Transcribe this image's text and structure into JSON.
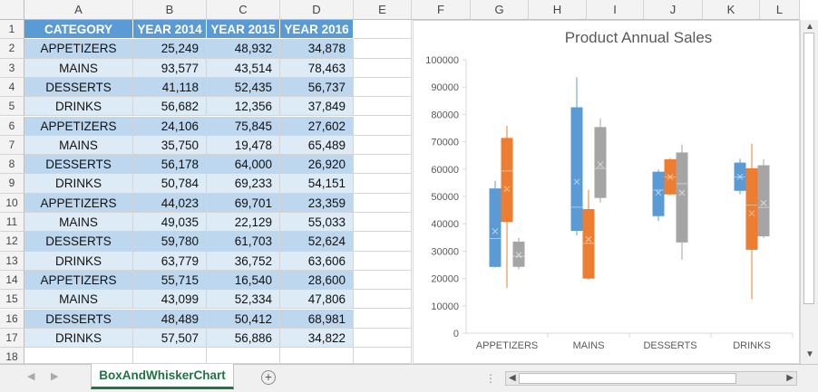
{
  "column_headers": [
    "A",
    "B",
    "C",
    "D",
    "E",
    "F",
    "G",
    "H",
    "I",
    "J",
    "K",
    "L"
  ],
  "row_numbers": [
    "1",
    "2",
    "3",
    "4",
    "5",
    "6",
    "7",
    "8",
    "9",
    "10",
    "11",
    "12",
    "13",
    "14",
    "15",
    "16",
    "17",
    "18"
  ],
  "table": {
    "headers": [
      "CATEGORY",
      "YEAR 2014",
      "YEAR 2015",
      "YEAR 2016"
    ],
    "rows": [
      [
        "APPETIZERS",
        "25,249",
        "48,932",
        "34,878"
      ],
      [
        "MAINS",
        "93,577",
        "43,514",
        "78,463"
      ],
      [
        "DESSERTS",
        "41,118",
        "52,435",
        "56,737"
      ],
      [
        "DRINKS",
        "56,682",
        "12,356",
        "37,849"
      ],
      [
        "APPETIZERS",
        "24,106",
        "75,845",
        "27,602"
      ],
      [
        "MAINS",
        "35,750",
        "19,478",
        "65,489"
      ],
      [
        "DESSERTS",
        "56,178",
        "64,000",
        "26,920"
      ],
      [
        "DRINKS",
        "50,784",
        "69,233",
        "54,151"
      ],
      [
        "APPETIZERS",
        "44,023",
        "69,701",
        "23,359"
      ],
      [
        "MAINS",
        "49,035",
        "22,129",
        "55,033"
      ],
      [
        "DESSERTS",
        "59,780",
        "61,703",
        "52,624"
      ],
      [
        "DRINKS",
        "63,779",
        "36,752",
        "63,606"
      ],
      [
        "APPETIZERS",
        "55,715",
        "16,540",
        "28,600"
      ],
      [
        "MAINS",
        "43,099",
        "52,334",
        "47,806"
      ],
      [
        "DESSERTS",
        "48,489",
        "50,412",
        "68,981"
      ],
      [
        "DRINKS",
        "57,507",
        "56,886",
        "34,822"
      ]
    ]
  },
  "sheet_tab": "BoxAndWhiskerChart",
  "colors": {
    "header": "#5b9bd5",
    "band_dark": "#bdd7ee",
    "band_light": "#ddebf7",
    "series_2014": "#5b9bd5",
    "series_2015": "#ed7d31",
    "series_2016": "#a5a5a5",
    "tab_accent": "#217346"
  },
  "chart_data": {
    "type": "box",
    "title": "Product Annual Sales",
    "categories": [
      "APPETIZERS",
      "MAINS",
      "DESSERTS",
      "DRINKS"
    ],
    "ylim": [
      0,
      100000
    ],
    "yticks": [
      "0",
      "10000",
      "20000",
      "30000",
      "40000",
      "50000",
      "60000",
      "70000",
      "80000",
      "90000",
      "100000"
    ],
    "grid": false,
    "series": [
      {
        "color": "#5b9bd5",
        "boxes": [
          {
            "min": 24106,
            "q1": 24392,
            "median": 34636,
            "q3": 52767,
            "max": 55715,
            "mean": 37273
          },
          {
            "min": 35750,
            "q1": 37587,
            "median": 46067,
            "q3": 82442,
            "max": 93577,
            "mean": 55365
          },
          {
            "min": 41118,
            "q1": 42961,
            "median": 52334,
            "q3": 58880,
            "max": 59780,
            "mean": 51391
          },
          {
            "min": 50784,
            "q1": 52234,
            "median": 57095,
            "q3": 62211,
            "max": 63779,
            "mean": 57188
          }
        ]
      },
      {
        "color": "#ed7d31",
        "boxes": [
          {
            "min": 16540,
            "q1": 40834,
            "median": 59317,
            "q3": 71237,
            "max": 75845,
            "mean": 52755
          },
          {
            "min": 19478,
            "q1": 20141,
            "median": 32822,
            "q3": 45219,
            "max": 52334,
            "mean": 34364
          },
          {
            "min": 50412,
            "q1": 50918,
            "median": 57069,
            "q3": 63426,
            "max": 64000,
            "mean": 57138
          },
          {
            "min": 12356,
            "q1": 30653,
            "median": 46819,
            "q3": 60161,
            "max": 69233,
            "mean": 43807
          }
        ]
      },
      {
        "color": "#a5a5a5",
        "boxes": [
          {
            "min": 23359,
            "q1": 24420,
            "median": 28101,
            "q3": 33309,
            "max": 34878,
            "mean": 28610
          },
          {
            "min": 47806,
            "q1": 49613,
            "median": 60261,
            "q3": 75220,
            "max": 78463,
            "mean": 61698
          },
          {
            "min": 26920,
            "q1": 33346,
            "median": 54681,
            "q3": 65920,
            "max": 68981,
            "mean": 51316
          },
          {
            "min": 34822,
            "q1": 35586,
            "median": 46000,
            "q3": 61242,
            "max": 63606,
            "mean": 47607
          }
        ]
      }
    ]
  }
}
